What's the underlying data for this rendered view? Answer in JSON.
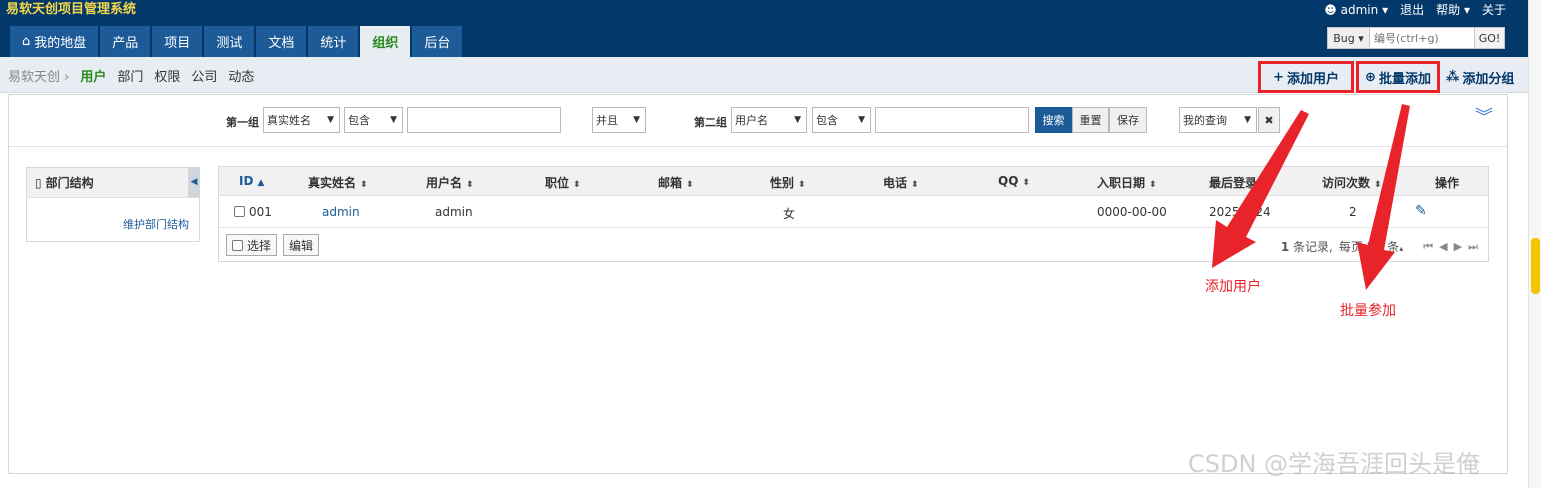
{
  "header": {
    "app_title": "易软天创项目管理系统",
    "user": "admin",
    "logout": "退出",
    "help": "帮助",
    "about": "关于",
    "nav_tabs": [
      {
        "label": "我的地盘",
        "icon": "home-icon"
      },
      {
        "label": "产品"
      },
      {
        "label": "项目"
      },
      {
        "label": "测试"
      },
      {
        "label": "文档"
      },
      {
        "label": "统计"
      },
      {
        "label": "组织",
        "active": true
      },
      {
        "label": "后台"
      }
    ],
    "quick_search": {
      "type": "Bug",
      "placeholder": "编号(ctrl+g)",
      "go": "GO!"
    }
  },
  "subnav": {
    "root": "易软天创",
    "items": [
      "用户",
      "部门",
      "权限",
      "公司",
      "动态"
    ],
    "actions": {
      "add_user": "添加用户",
      "batch_add": "批量添加",
      "add_group": "添加分组"
    }
  },
  "search": {
    "group1_label": "第一组",
    "group1_field": "真实姓名",
    "group1_op": "包含",
    "group1_value": "",
    "join": "并且",
    "group2_label": "第二组",
    "group2_field": "用户名",
    "group2_op": "包含",
    "group2_value": "",
    "search_btn": "搜索",
    "reset_btn": "重置",
    "save_btn": "保存",
    "my_query": "我的查询",
    "clear": "✖"
  },
  "dept": {
    "title": "部门结构",
    "maintain": "维护部门结构"
  },
  "table": {
    "columns": [
      "ID",
      "真实姓名",
      "用户名",
      "职位",
      "邮箱",
      "性别",
      "电话",
      "QQ",
      "入职日期",
      "最后登录",
      "访问次数",
      "操作"
    ],
    "rows": [
      {
        "id": "001",
        "realname": "admin",
        "username": "admin",
        "position": "",
        "email": "",
        "gender": "女",
        "phone": "",
        "qq": "",
        "join_date": "0000-00-00",
        "last_login": "2025-0 24",
        "visits": "2"
      }
    ],
    "footer": {
      "select": "选择",
      "edit": "编辑"
    },
    "pager": {
      "total_prefix": "1",
      "total_suffix": "条记录,",
      "per_page": "每页",
      "per_page_num": "20",
      "per_page_unit": "条"
    }
  },
  "annotations": {
    "add_user": "添加用户",
    "batch_add": "批量参加"
  },
  "watermark": "CSDN @学海吾涯回头是俺",
  "colors": {
    "header_bg": "#03386a",
    "nav_tab": "#1d5b98",
    "active_green": "#2b8a1e",
    "annotation_red": "#e8242a",
    "title_yellow": "#f4d64b"
  }
}
